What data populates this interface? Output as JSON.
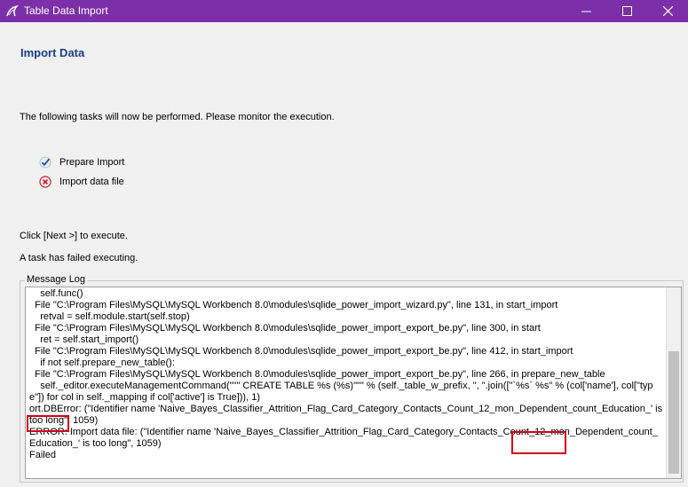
{
  "window": {
    "title": "Table Data Import",
    "minimize_glyph": "─",
    "maximize_glyph": "☐",
    "close_glyph": "✕"
  },
  "page": {
    "section_title": "Import Data",
    "intro": "The following tasks will now be performed. Please monitor the execution.",
    "tasks": [
      {
        "label": "Prepare Import",
        "status": "done",
        "icon": "check-icon"
      },
      {
        "label": "Import data file",
        "status": "failed",
        "icon": "error-icon"
      }
    ],
    "hint_next": "Click [Next >] to execute.",
    "hint_failed": "A task has failed executing."
  },
  "log": {
    "label": "Message Log",
    "text": "    self.func()\n  File \"C:\\Program Files\\MySQL\\MySQL Workbench 8.0\\modules\\sqlide_power_import_wizard.py\", line 131, in start_import\n    retval = self.module.start(self.stop)\n  File \"C:\\Program Files\\MySQL\\MySQL Workbench 8.0\\modules\\sqlide_power_import_export_be.py\", line 300, in start\n    ret = self.start_import()\n  File \"C:\\Program Files\\MySQL\\MySQL Workbench 8.0\\modules\\sqlide_power_import_export_be.py\", line 412, in start_import\n    if not self.prepare_new_table():\n  File \"C:\\Program Files\\MySQL\\MySQL Workbench 8.0\\modules\\sqlide_power_import_export_be.py\", line 266, in prepare_new_table\n    self._editor.executeManagementCommand(\"\"\" CREATE TABLE %s (%s)\"\"\" % (self._table_w_prefix, \", \".join([\"`%s` %s\" % (col['name'], col[\"type\"]) for col in self._mapping if col['active'] is True])), 1)\nort.DBError: (\"Identifier name 'Naive_Bayes_Classifier_Attrition_Flag_Card_Category_Contacts_Count_12_mon_Dependent_count_Education_' is too long\", 1059)\nERROR: Import data file: (\"Identifier name 'Naive_Bayes_Classifier_Attrition_Flag_Card_Category_Contacts_Count_12_mon_Dependent_count_Education_' is too long\", 1059)\nFailed"
  },
  "colors": {
    "titlebar": "#7b2fa8",
    "section_title": "#1a3e8c",
    "highlight": "#d0001b",
    "check": "#1c4e9b",
    "error": "#c8161d"
  }
}
